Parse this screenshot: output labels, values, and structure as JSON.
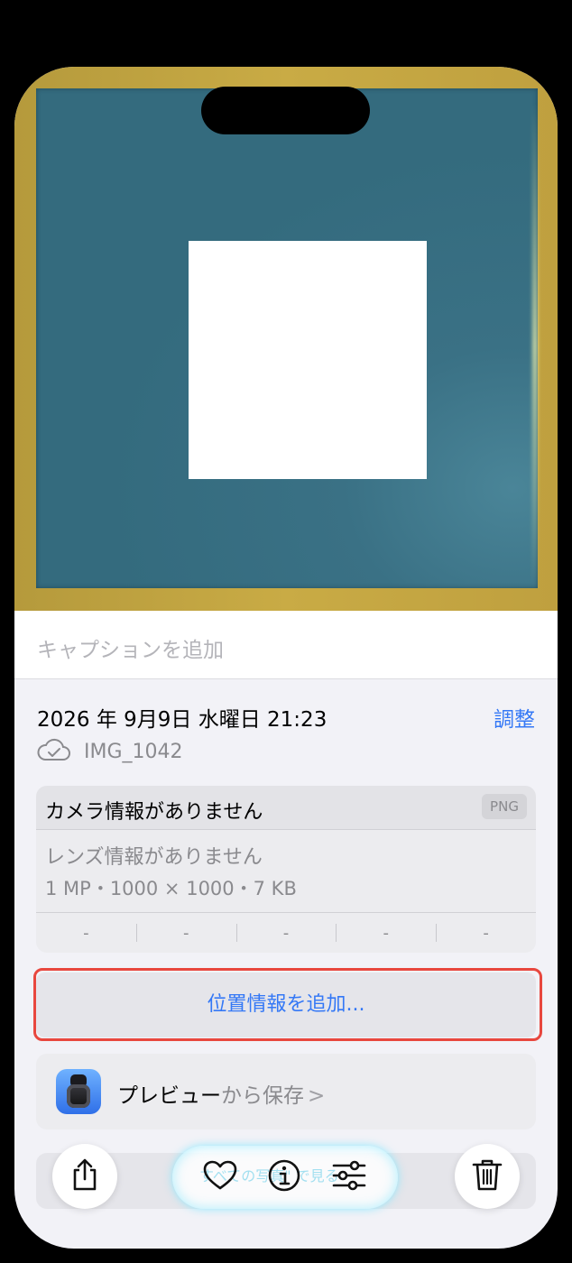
{
  "caption": {
    "placeholder": "キャプションを追加"
  },
  "details": {
    "date": "2026 年 9月9日 水曜日 21:23",
    "adjust_label": "調整",
    "file_name": "IMG_1042"
  },
  "camera_info": {
    "camera": "カメラ情報がありません",
    "format_badge": "PNG",
    "lens": "レンズ情報がありません",
    "specs": "1 MP・1000 × 1000・7 KB",
    "exif_values": [
      "-",
      "-",
      "-",
      "-",
      "-"
    ]
  },
  "location": {
    "add_label": "位置情報を追加..."
  },
  "save_source": {
    "app_name": "プレビュー",
    "suffix": "から保存",
    "chevron": ">"
  },
  "toolbar": {
    "ghost_text": "すべての写真\" で見る"
  },
  "colors": {
    "accent": "#3478f6",
    "highlight": "#e8473e",
    "photo_frame": "#c9ab45",
    "photo_background": "#346b7e"
  }
}
